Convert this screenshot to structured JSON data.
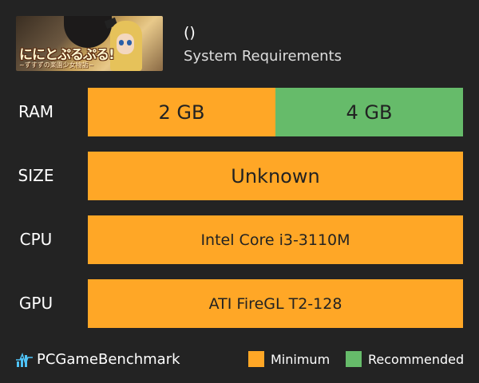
{
  "header": {
    "game_title": "()",
    "subtitle": "System Requirements",
    "thumbnail": {
      "logo_text": "ににとぷるぷる!",
      "logo_subtext": "~ずすずの楽園少女物語~"
    }
  },
  "requirements": [
    {
      "label": "RAM",
      "minimum": "2 GB",
      "recommended": "4 GB"
    },
    {
      "label": "SIZE",
      "minimum": "Unknown"
    },
    {
      "label": "CPU",
      "minimum": "Intel Core i3-3110M"
    },
    {
      "label": "GPU",
      "minimum": "ATI FireGL T2-128"
    }
  ],
  "footer": {
    "brand": "PCGameBenchmark",
    "brand_icon": "bar-chart-pulse-icon",
    "legend": [
      {
        "label": "Minimum",
        "color": "#ffa726"
      },
      {
        "label": "Recommended",
        "color": "#66bb6a"
      }
    ]
  },
  "colors": {
    "background": "#232323",
    "minimum": "#ffa726",
    "recommended": "#66bb6a"
  }
}
